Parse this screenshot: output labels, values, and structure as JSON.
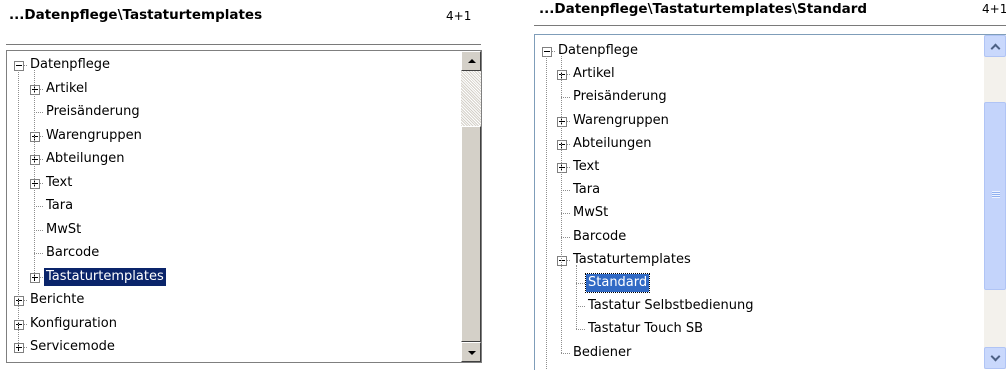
{
  "left_panel": {
    "title": "...Datenpflege\\Tastaturtemplates",
    "counter": "4+1",
    "tree": [
      {
        "label": "Datenpflege",
        "level": 0,
        "expander": "minus"
      },
      {
        "label": "Artikel",
        "level": 1,
        "expander": "plus"
      },
      {
        "label": "Preisänderung",
        "level": 1,
        "expander": "none"
      },
      {
        "label": "Warengruppen",
        "level": 1,
        "expander": "plus"
      },
      {
        "label": "Abteilungen",
        "level": 1,
        "expander": "plus"
      },
      {
        "label": "Text",
        "level": 1,
        "expander": "plus"
      },
      {
        "label": "Tara",
        "level": 1,
        "expander": "none"
      },
      {
        "label": "MwSt",
        "level": 1,
        "expander": "none"
      },
      {
        "label": "Barcode",
        "level": 1,
        "expander": "none"
      },
      {
        "label": "Tastaturtemplates",
        "level": 1,
        "expander": "plus",
        "selected": true
      },
      {
        "label": "Berichte",
        "level": 0,
        "expander": "plus"
      },
      {
        "label": "Konfiguration",
        "level": 0,
        "expander": "plus"
      },
      {
        "label": "Servicemode",
        "level": 0,
        "expander": "plus"
      }
    ]
  },
  "right_panel": {
    "title": "...Datenpflege\\Tastaturtemplates\\Standard",
    "counter": "4+1",
    "tree": [
      {
        "label": "Datenpflege",
        "level": 0,
        "expander": "minus"
      },
      {
        "label": "Artikel",
        "level": 1,
        "expander": "plus"
      },
      {
        "label": "Preisänderung",
        "level": 1,
        "expander": "none"
      },
      {
        "label": "Warengruppen",
        "level": 1,
        "expander": "plus"
      },
      {
        "label": "Abteilungen",
        "level": 1,
        "expander": "plus"
      },
      {
        "label": "Text",
        "level": 1,
        "expander": "plus"
      },
      {
        "label": "Tara",
        "level": 1,
        "expander": "none"
      },
      {
        "label": "MwSt",
        "level": 1,
        "expander": "none"
      },
      {
        "label": "Barcode",
        "level": 1,
        "expander": "none"
      },
      {
        "label": "Tastaturtemplates",
        "level": 1,
        "expander": "minus"
      },
      {
        "label": "Standard",
        "level": 2,
        "expander": "none",
        "selected": true
      },
      {
        "label": "Tastatur Selbstbedienung",
        "level": 2,
        "expander": "none"
      },
      {
        "label": "Tastatur Touch SB",
        "level": 2,
        "expander": "none"
      },
      {
        "label": "Bediener",
        "level": 1,
        "expander": "none"
      }
    ]
  },
  "icons": {
    "expand": "plus-box-icon",
    "collapse": "minus-box-icon",
    "scroll_up": "arrow-up-icon",
    "scroll_down": "arrow-down-icon"
  },
  "colors": {
    "selection_left": "#0a246a",
    "selection_right": "#316ac5",
    "scroll_xp": "#c4d4fb"
  }
}
